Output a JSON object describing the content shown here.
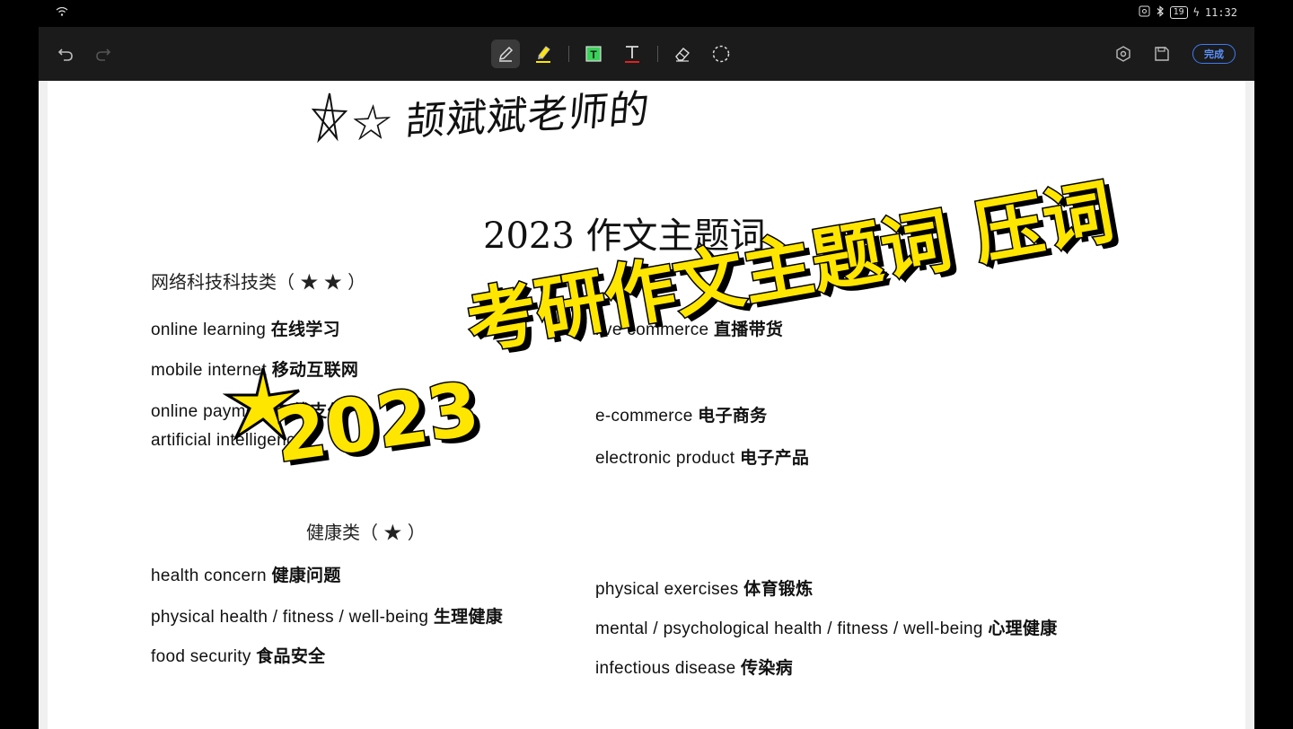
{
  "status_bar": {
    "wifi_icon": "wifi-icon",
    "battery": "19",
    "time": "11:32"
  },
  "toolbar": {
    "tools": [
      "undo-icon",
      "redo-icon",
      "pen-icon",
      "highlighter-icon",
      "textbox-icon",
      "text-icon",
      "eraser-icon",
      "lasso-icon"
    ],
    "done_label": "完成",
    "colors": {
      "accent": "#3d7cf5",
      "highlighter": "#ffe600",
      "textbox": "#3ad15a",
      "text_red": "#e02020"
    }
  },
  "document": {
    "handwriting": "☆ 颉斌斌老师的",
    "title": "2023 作文主题词",
    "section1": {
      "heading": "网络科技科技类（ ★ ★ ）",
      "left_terms": [
        {
          "en": "online learning",
          "zh": "在线学习"
        },
        {
          "en": "mobile internet",
          "zh": "移动互联网"
        },
        {
          "en": "online payment",
          "zh": "在线支付"
        },
        {
          "en": "artificial intelligence",
          "zh": ""
        }
      ],
      "right_terms": [
        {
          "en": "live commerce",
          "zh": "直播带货"
        },
        {
          "en": "e-commerce",
          "zh": "电子商务"
        },
        {
          "en": "electronic product",
          "zh": "电子产品"
        }
      ]
    },
    "section2": {
      "heading": "健康类（ ★ ）",
      "left_terms": [
        {
          "en": "health concern",
          "zh": "健康问题"
        },
        {
          "en": "physical health / fitness / well-being",
          "zh": "生理健康"
        },
        {
          "en": "food security",
          "zh": "食品安全"
        }
      ],
      "right_terms": [
        {
          "en": "physical exercises",
          "zh": "体育锻炼"
        },
        {
          "en": "mental / psychological health / fitness / well-being",
          "zh": "心理健康"
        },
        {
          "en": "infectious disease",
          "zh": "传染病"
        }
      ]
    }
  },
  "banner": {
    "line1": "考研作文主题词 压词",
    "line2": "2023"
  }
}
